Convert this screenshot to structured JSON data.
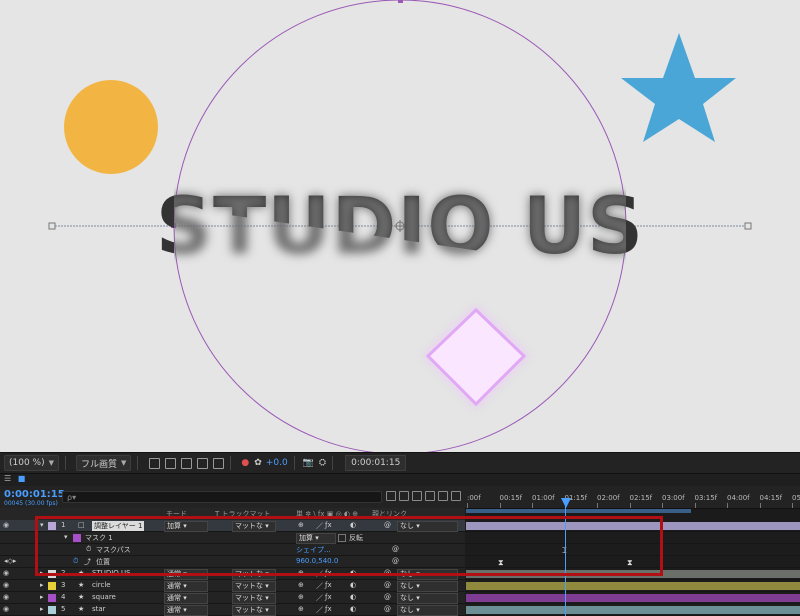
{
  "composition": {
    "title_text": "STUDIO US",
    "colors": {
      "background": "#e5e5e5",
      "circle": "#f2b544",
      "star": "#4aa6d6",
      "diamond_fill": "#fbe6ff",
      "diamond_glow": "#d98cf2",
      "mask_path": "#9b59b6",
      "text": "#333333"
    }
  },
  "viewer_toolbar": {
    "zoom": "(100 %)",
    "quality": "フル画質",
    "exposure": "+0.0",
    "timecode": "0:00:01:15"
  },
  "timeline": {
    "current_time": "0:00:01:15",
    "current_time_sub": "00045 (30.00 fps)",
    "search_placeholder": "ρ▾",
    "ruler_labels": [
      ":00f",
      "00:15f",
      "01:00f",
      "01:15f",
      "02:00f",
      "02:15f",
      "03:00f",
      "03:15f",
      "04:00f",
      "04:15f",
      "05:0"
    ],
    "column_headers": {
      "mode": "モード",
      "trkmat": "T トラックマット",
      "switches": "単 ✲ \\ fx ▣ ◎ ◐ ⊕",
      "parent": "親とリンク"
    },
    "layers": [
      {
        "num": "1",
        "name": "調整レイヤー 1",
        "mode": "加算",
        "matte": "マットな",
        "parent": "なし",
        "label_color": "#b7a6d6",
        "bar_color": "#9d97bf"
      },
      {
        "row_type": "mask",
        "name": "マスク 1",
        "mode": "加算",
        "inverted_label": "反転"
      },
      {
        "row_type": "mask_path",
        "name": "マスクパス",
        "value": "シェイプ..."
      },
      {
        "row_type": "position",
        "name": "位置",
        "value": "960.0,540.0"
      },
      {
        "num": "2",
        "name": "STUDIO US",
        "mode": "通常",
        "matte": "マットな",
        "parent": "なし",
        "label_color": "#d9d9d9",
        "bar_color": "#6a6f6a"
      },
      {
        "num": "3",
        "name": "circle",
        "mode": "通常",
        "matte": "マットな",
        "parent": "なし",
        "label_color": "#e6cf3a",
        "bar_color": "#8f8a3e"
      },
      {
        "num": "4",
        "name": "square",
        "mode": "通常",
        "matte": "マットな",
        "parent": "なし",
        "label_color": "#a64fc7",
        "bar_color": "#7e3d93"
      },
      {
        "num": "5",
        "name": "star",
        "mode": "通常",
        "matte": "マットな",
        "parent": "なし",
        "label_color": "#a9d0d6",
        "bar_color": "#6b8f94"
      }
    ],
    "highlight_color": "#b00f14"
  }
}
